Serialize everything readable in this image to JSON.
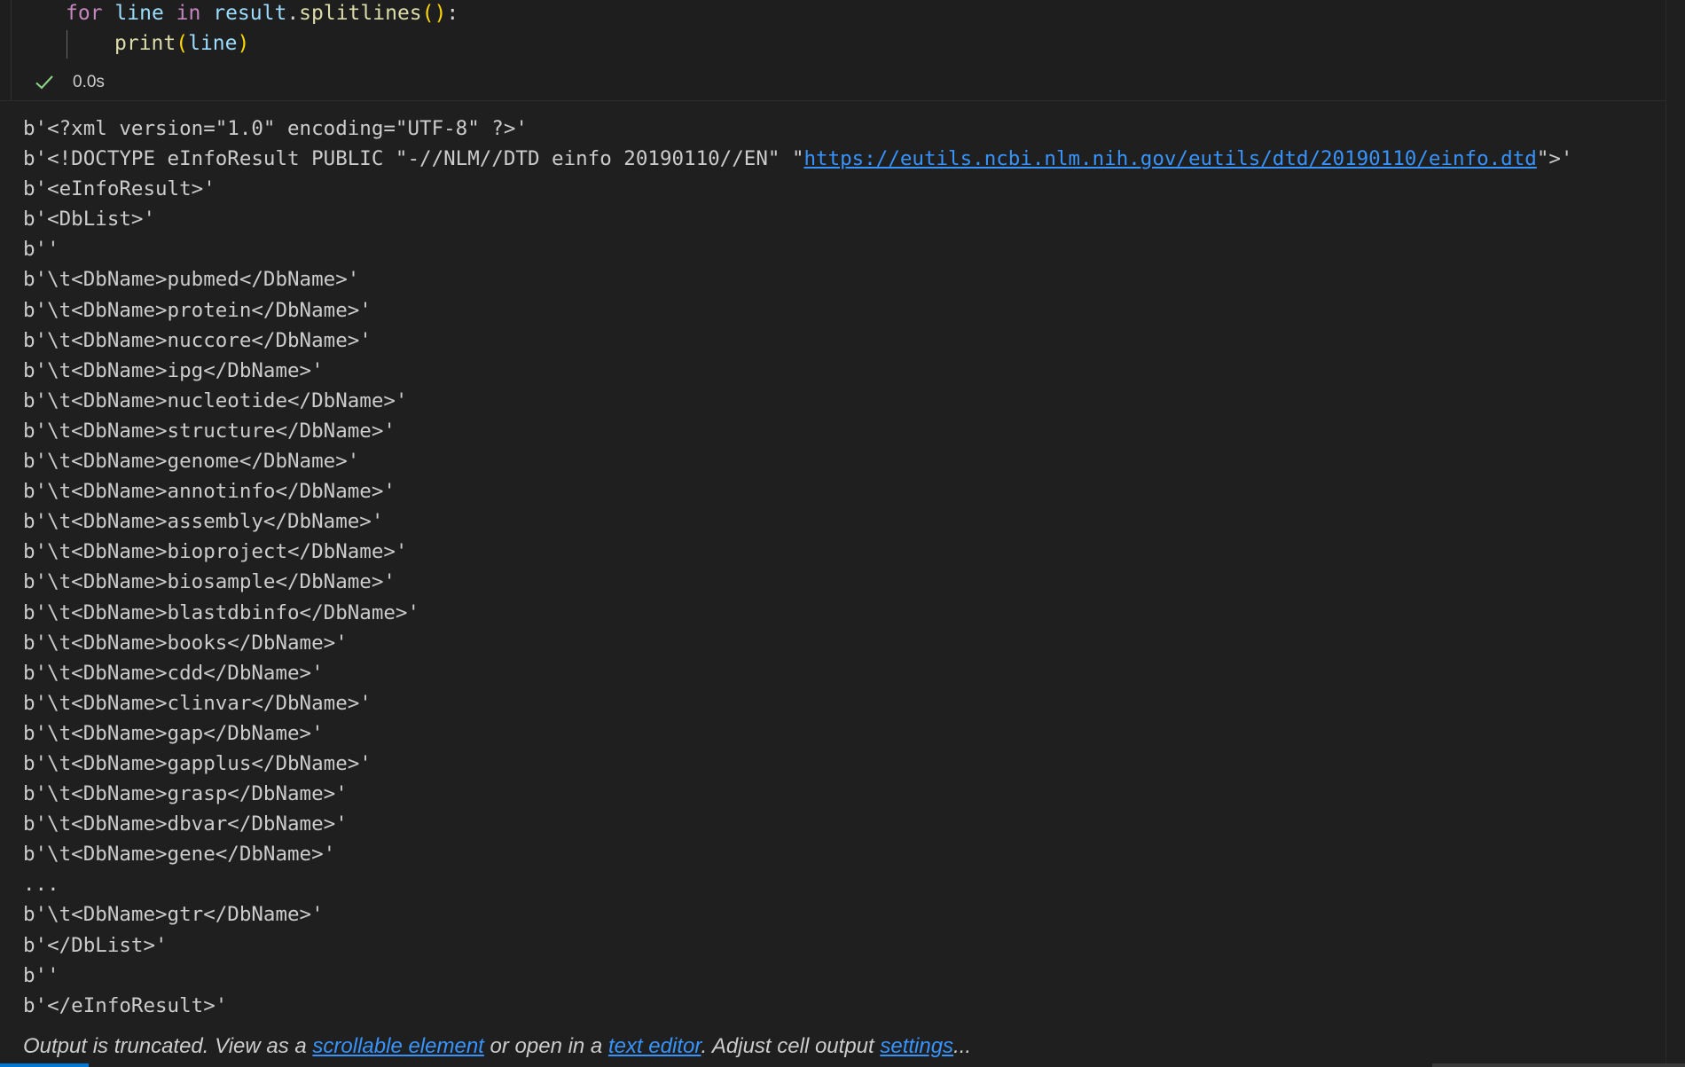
{
  "code": {
    "line1": {
      "for": "for",
      "var1": "line",
      "in": "in",
      "obj": "result",
      "dot": ".",
      "method": "splitlines",
      "open": "(",
      "close": ")",
      "colon": ":"
    },
    "line2": {
      "fn": "print",
      "open": "(",
      "arg": "line",
      "close": ")"
    }
  },
  "status": {
    "duration": "0.0s"
  },
  "output": {
    "lines": [
      "b'<?xml version=\"1.0\" encoding=\"UTF-8\" ?>'",
      "b'<eInfoResult>'",
      "b'<DbList>'",
      "b''",
      "b'\\t<DbName>pubmed</DbName>'",
      "b'\\t<DbName>protein</DbName>'",
      "b'\\t<DbName>nuccore</DbName>'",
      "b'\\t<DbName>ipg</DbName>'",
      "b'\\t<DbName>nucleotide</DbName>'",
      "b'\\t<DbName>structure</DbName>'",
      "b'\\t<DbName>genome</DbName>'",
      "b'\\t<DbName>annotinfo</DbName>'",
      "b'\\t<DbName>assembly</DbName>'",
      "b'\\t<DbName>bioproject</DbName>'",
      "b'\\t<DbName>biosample</DbName>'",
      "b'\\t<DbName>blastdbinfo</DbName>'",
      "b'\\t<DbName>books</DbName>'",
      "b'\\t<DbName>cdd</DbName>'",
      "b'\\t<DbName>clinvar</DbName>'",
      "b'\\t<DbName>gap</DbName>'",
      "b'\\t<DbName>gapplus</DbName>'",
      "b'\\t<DbName>grasp</DbName>'",
      "b'\\t<DbName>dbvar</DbName>'",
      "b'\\t<DbName>gene</DbName>'",
      "...",
      "b'\\t<DbName>gtr</DbName>'",
      "b'</DbList>'",
      "b''",
      "b'</eInfoResult>'"
    ],
    "doctype_prefix": "b'<!DOCTYPE eInfoResult PUBLIC \"-//NLM//DTD einfo 20190110//EN\" \"",
    "doctype_link": "https://eutils.ncbi.nlm.nih.gov/eutils/dtd/20190110/einfo.dtd",
    "doctype_suffix": "\">'"
  },
  "truncation": {
    "prefix": "Output is truncated. View as a ",
    "scrollable_link": "scrollable element",
    "middle": " or open in a ",
    "editor_link": "text editor",
    "middle2": ". Adjust cell output ",
    "settings_link": "settings",
    "suffix": "..."
  },
  "colors": {
    "link": "#3794ff",
    "check": "#89d185",
    "accent": "#0078d4"
  },
  "icons": {
    "status": "check-icon"
  }
}
